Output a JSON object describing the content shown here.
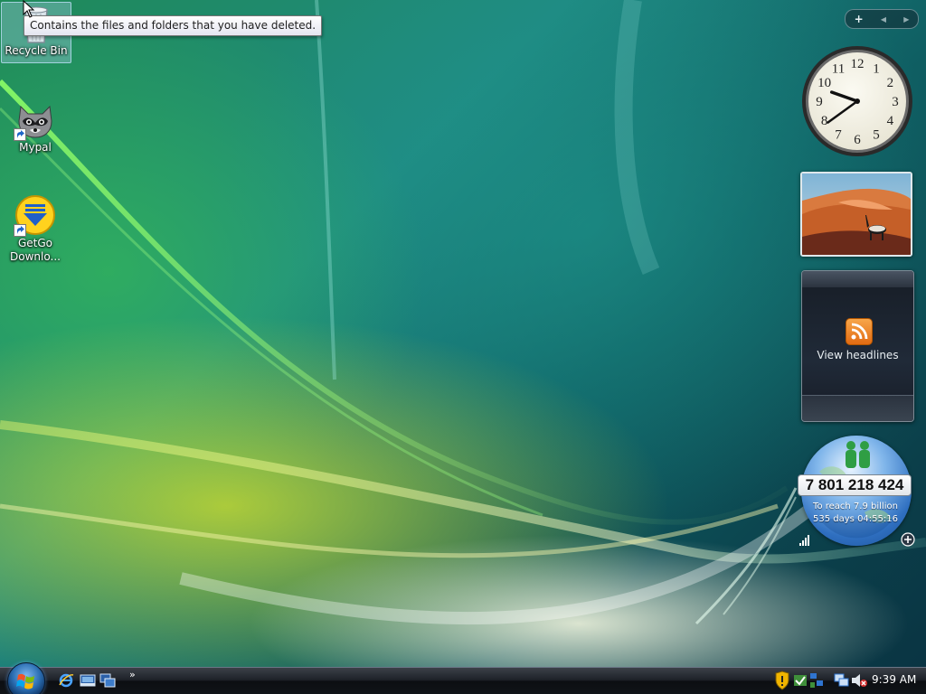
{
  "desktop": {
    "icons": [
      {
        "label": "Recycle Bin",
        "icon": "recycle-bin-icon"
      },
      {
        "label": "Mypal",
        "icon": "raccoon-icon"
      },
      {
        "label": "GetGo Downlo...",
        "icon": "getgo-download-icon"
      }
    ],
    "tooltip": "Contains the files and folders that you have deleted."
  },
  "sidebar": {
    "toolbar": {
      "add": "+",
      "prev": "◀",
      "next": "▶"
    },
    "clock": {
      "time": "9:39",
      "numbers": [
        "12",
        "1",
        "2",
        "3",
        "4",
        "5",
        "6",
        "7",
        "8",
        "9",
        "10",
        "11"
      ]
    },
    "feed": {
      "label": "View headlines"
    },
    "population": {
      "count": "7 801 218 424",
      "line1": "To reach 7.9 billion",
      "line2": "535 days 04:55:16"
    }
  },
  "taskbar": {
    "quicklaunch_chevron": "»",
    "clock": "9:39 AM"
  },
  "colors": {
    "taskbar": "#1d2128",
    "rss": "#f08a24",
    "tooltip_bg": "#ffffff"
  }
}
